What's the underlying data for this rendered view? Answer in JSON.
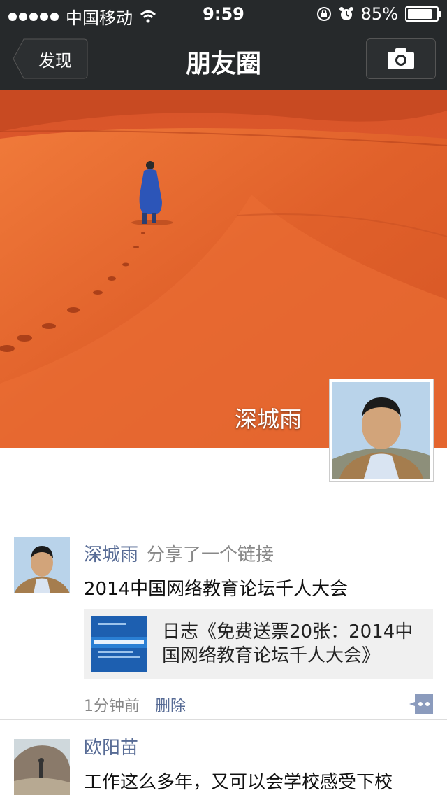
{
  "status_bar": {
    "carrier": "中国移动",
    "time": "9:59",
    "battery": "85%",
    "battery_level": 0.85
  },
  "nav": {
    "back_label": "发现",
    "title": "朋友圈",
    "camera_icon": "camera-icon"
  },
  "profile": {
    "name": "深城雨"
  },
  "posts": [
    {
      "author": "深城雨",
      "action": "分享了一个链接",
      "text": "2014中国网络教育论坛千人大会",
      "link_title_line1": "日志《免费送票20张：2014中",
      "link_title_line2": "国网络教育论坛千人大会》",
      "time": "1分钟前",
      "delete_label": "删除"
    },
    {
      "author": "欧阳苗",
      "text": "工作这么多年，又可以会学校感受下校"
    }
  ],
  "colors": {
    "bar_bg": "#26292b",
    "name_blue": "#576b95",
    "sand": "#e2622b"
  }
}
